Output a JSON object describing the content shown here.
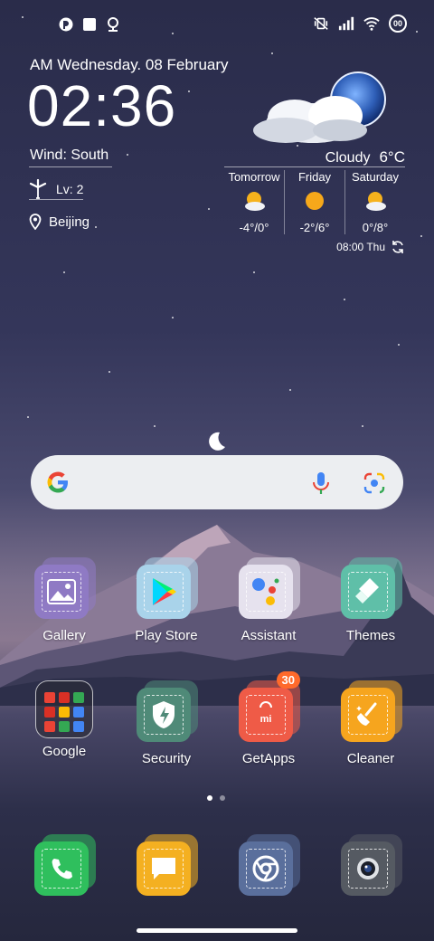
{
  "statusbar": {
    "left_icons": [
      "notification-app-icon",
      "square-notification-icon",
      "location-pin-icon"
    ],
    "right_icons": [
      "vibrate-off-icon",
      "signal-icon",
      "wifi-icon"
    ],
    "battery_text": "00"
  },
  "clock": {
    "date": "AM Wednesday. 08 February",
    "time": "02:36",
    "wind": "Wind: South",
    "level": "Lv: 2",
    "city": "Beijing"
  },
  "weather": {
    "condition": "Cloudy",
    "temperature": "6°C",
    "forecast": [
      {
        "day": "Tomorrow",
        "range": "-4°/0°",
        "icon": "sun-cloud-icon"
      },
      {
        "day": "Friday",
        "range": "-2°/6°",
        "icon": "sun-icon"
      },
      {
        "day": "Saturday",
        "range": "0°/8°",
        "icon": "sun-cloud-icon"
      }
    ],
    "updated": "08:00 Thu"
  },
  "search": {
    "icons": [
      "google-logo-icon",
      "microphone-icon",
      "lens-camera-icon"
    ]
  },
  "apps": {
    "gallery": "Gallery",
    "play_store": "Play Store",
    "assistant": "Assistant",
    "themes": "Themes",
    "google": "Google",
    "security": "Security",
    "getapps": "GetApps",
    "getapps_badge": "30",
    "cleaner": "Cleaner"
  },
  "dock": {
    "icons": [
      "phone-icon",
      "messages-icon",
      "chrome-icon",
      "camera-icon"
    ]
  },
  "colors": {
    "gallery": "#8f7ac4",
    "play_store": "#a9d3ea",
    "assistant": "#e6e2ee",
    "themes": "#5fbfa8",
    "security": "#4f8a78",
    "getapps": "#ef5b47",
    "cleaner": "#f6a51e",
    "phone": "#2fbf5d",
    "messages": "#f4b021",
    "chrome": "#5a6f9c",
    "camera": "#555a62",
    "badge": "#ff6a2b"
  },
  "page_indicator": {
    "count": 2,
    "active": 1
  }
}
